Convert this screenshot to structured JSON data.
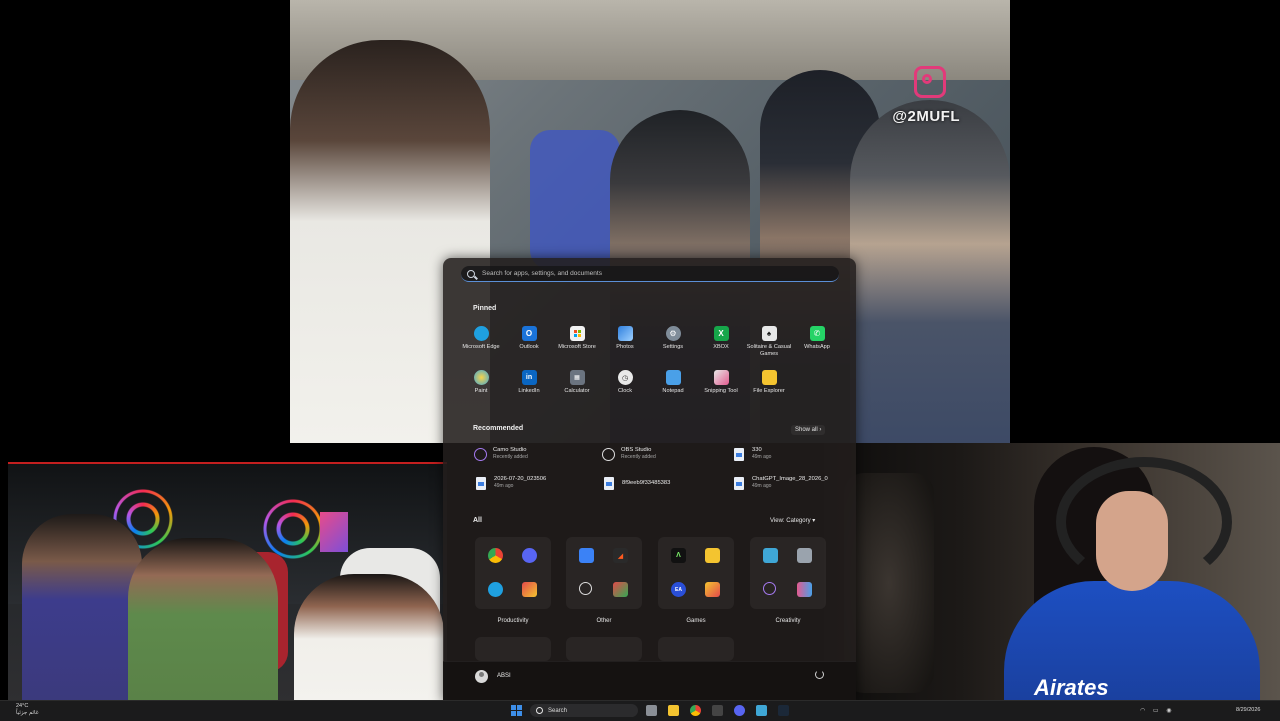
{
  "video_overlay": {
    "watermark": "@2MUFL"
  },
  "start_menu": {
    "search_placeholder": "Search for apps, settings, and documents",
    "pinned_title": "Pinned",
    "pinned": [
      {
        "label": "Microsoft Edge",
        "icon": "edge-icon",
        "color": "#1fa0e0"
      },
      {
        "label": "Outlook",
        "icon": "outlook-icon",
        "color": "#1a73d9"
      },
      {
        "label": "Microsoft Store",
        "icon": "store-icon",
        "color": "#f2f2f2"
      },
      {
        "label": "Photos",
        "icon": "photos-icon",
        "color": "#2f7fde"
      },
      {
        "label": "Settings",
        "icon": "gear-icon",
        "color": "#7f8c99"
      },
      {
        "label": "XBOX",
        "icon": "xbox-icon",
        "color": "#16a64a"
      },
      {
        "label": "Solitaire & Casual Games",
        "icon": "solitaire-icon",
        "color": "#e8e8e8"
      },
      {
        "label": "WhatsApp",
        "icon": "whatsapp-icon",
        "color": "#25d366"
      },
      {
        "label": "Paint",
        "icon": "paint-icon",
        "color": "#3fa7d6"
      },
      {
        "label": "LinkedIn",
        "icon": "linkedin-icon",
        "color": "#0a66c2"
      },
      {
        "label": "Calculator",
        "icon": "calculator-icon",
        "color": "#6b7480"
      },
      {
        "label": "Clock",
        "icon": "clock-icon",
        "color": "#e9e9e9"
      },
      {
        "label": "Notepad",
        "icon": "notepad-icon",
        "color": "#4aa0e8"
      },
      {
        "label": "Snipping Tool",
        "icon": "snipping-tool-icon",
        "color": "#e8e8e8"
      },
      {
        "label": "File Explorer",
        "icon": "folder-icon",
        "color": "#f4c430"
      }
    ],
    "recommended_title": "Recommended",
    "show_all_label": "Show all",
    "recommended": [
      {
        "title": "Camo Studio",
        "subtitle": "Recently added",
        "icon": "camo-icon"
      },
      {
        "title": "OBS Studio",
        "subtitle": "Recently added",
        "icon": "obs-icon"
      },
      {
        "title": "330",
        "subtitle": "49m ago",
        "icon": "document-icon"
      },
      {
        "title": "2026-07-20_023506",
        "subtitle": "49m ago",
        "icon": "document-icon"
      },
      {
        "title": "8f9eeb9f33485383",
        "subtitle": "",
        "icon": "document-icon"
      },
      {
        "title": "ChatGPT_Image_28_2026_0",
        "subtitle": "49m ago",
        "icon": "document-icon"
      }
    ],
    "all_title": "All",
    "view_label": "View: Category",
    "categories": [
      {
        "label": "Productivity"
      },
      {
        "label": "Other"
      },
      {
        "label": "Games"
      },
      {
        "label": "Creativity"
      }
    ],
    "user_name": "ABSI"
  },
  "taskbar": {
    "weather_temp": "24°C",
    "weather_text": "غائم جزئياً",
    "search_label": "Search",
    "date": "8/29/2026",
    "accent": "#3d8ee8"
  },
  "right_cam": {
    "jersey_text": "Airates"
  }
}
